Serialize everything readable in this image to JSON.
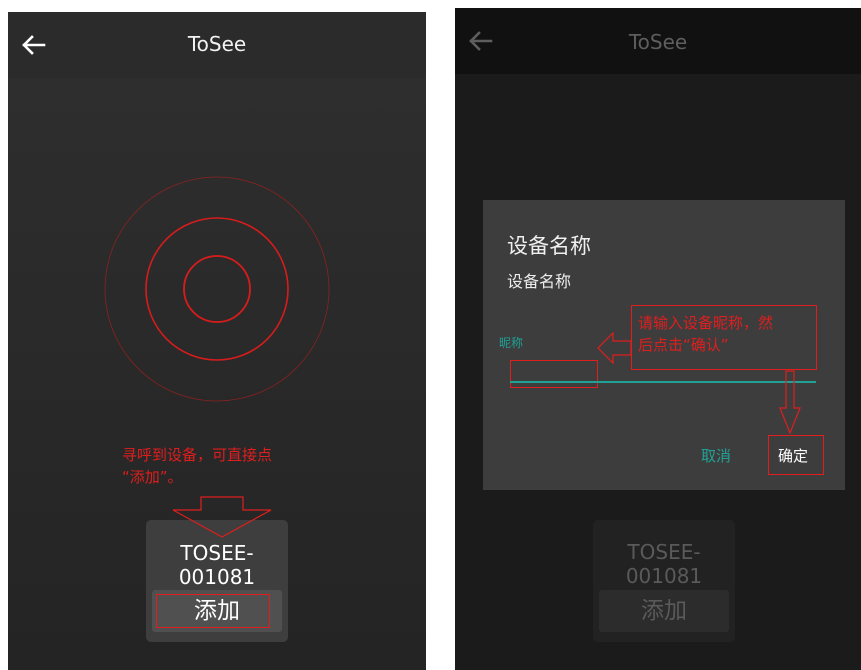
{
  "left": {
    "title": "ToSee",
    "annotation_line1": "寻呼到设备，可直接点",
    "annotation_line2": "“添加”。",
    "device_name": "TOSEE-001081",
    "add_label": "添加"
  },
  "right": {
    "title": "ToSee",
    "dialog": {
      "title": "设备名称",
      "message": "设备名称",
      "input_hint": "昵称",
      "annotation_line1": "请输入设备昵称，然",
      "annotation_line2": "后点击“确认”",
      "cancel_label": "取消",
      "confirm_label": "确定"
    },
    "device_name": "TOSEE-001081",
    "add_label": "添加"
  },
  "colors": {
    "accent": "#1fa397",
    "annotation": "#e01e1e",
    "radar": "#d81c1c"
  },
  "icons": {
    "back": "arrow-left-icon",
    "radar": "radar-rings-icon",
    "arrow": "down-arrow-outline-icon"
  }
}
